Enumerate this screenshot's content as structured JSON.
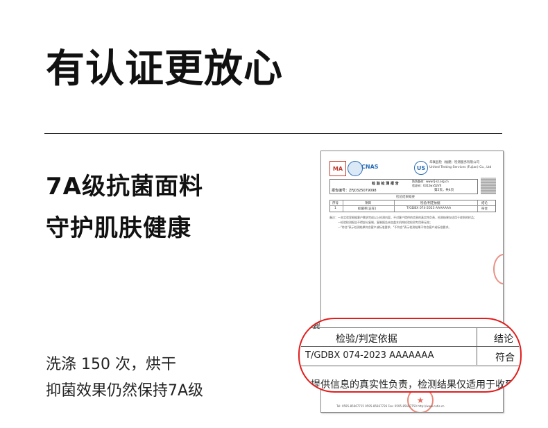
{
  "title": "有认证更放心",
  "headline": {
    "line1": "7A级抗菌面料",
    "line2": "守护肌肤健康"
  },
  "body": {
    "line1": "洗涤 150 次，烘干",
    "line2": "抑菌效果仍然保持7A级"
  },
  "report": {
    "logo_ma": "MA",
    "logo_cnas": "CNAS",
    "lab_logo": "US",
    "lab_name_cn": "华联品检（福建）检测服务有限公司",
    "lab_name_en": "United Testing Services (Fujian) Co., Ltd",
    "doc_title": "检 验 检 测 报 告",
    "report_no": "报告编号：ZFJ0325079098",
    "website": "防伪查询：www.fj-sz.org.cn",
    "verify": "验证码：0312wx52VX",
    "page": "第2页，共4页",
    "section": "检验结果概要",
    "table_headers": [
      "序号",
      "项目",
      "检验/判定依据",
      "结论"
    ],
    "table_row": [
      "1",
      "抑菌率[正在]",
      "T/GDBX 074-2023 AAAAAAA",
      "符合"
    ],
    "notes": [
      "备注：—本实验室根据客户需求完成以上检测内容，不对客户提供的信息的真实性负责，检测结果仅适用于收到的样品；",
      "—检验检测报告不得部分复制，复制报告未加盖本机构检验检测专用章无效；",
      "—\"符合\"表示检测结果符合客户或标准要求，\"不符合\"表示检测结果不符合客户或标准要求。"
    ],
    "footer": "Tel: 0595-85667715  0595-85667726    Fax: 0595-85667750    http://www.cutis.cn"
  },
  "callout": {
    "head_char": "要",
    "col1_header": "检验/判定依据",
    "col2_header": "结论",
    "col1_value": "T/GDBX 074-2023 AAAAAAA",
    "col2_value": "符合",
    "trail_text": "提供信息的真实性负责，检测结果仅适用于收到的"
  },
  "colors": {
    "highlight": "#e21d1d",
    "text": "#111111",
    "stamp": "#dc4632"
  }
}
